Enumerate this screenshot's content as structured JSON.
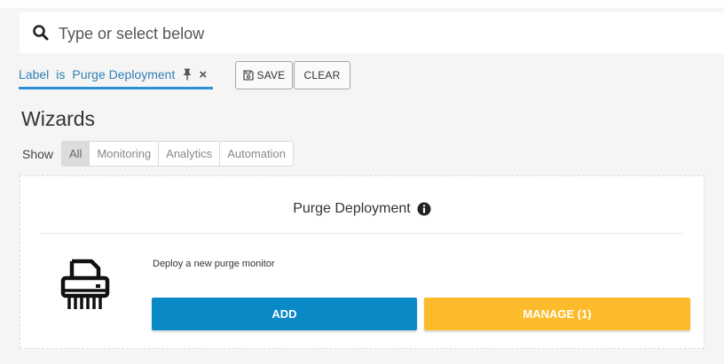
{
  "search": {
    "placeholder": "Type or select below",
    "icon": "search-icon"
  },
  "filter": {
    "key": "Label",
    "operator": "is",
    "value": "Purge Deployment",
    "pin_icon": "pin-icon",
    "remove_label": "×"
  },
  "toolbar": {
    "save_label": "SAVE",
    "clear_label": "CLEAR"
  },
  "page": {
    "title": "Wizards"
  },
  "show": {
    "label": "Show",
    "options": [
      "All",
      "Monitoring",
      "Analytics",
      "Automation"
    ],
    "selected": "All"
  },
  "card": {
    "title": "Purge Deployment",
    "info_icon": "info-icon",
    "image_icon": "shredder-icon",
    "description": "Deploy a new purge monitor",
    "add_label": "ADD",
    "manage_label": "MANAGE (1)"
  },
  "colors": {
    "accent_blue": "#2d8fd5",
    "add_button": "#0a89c7",
    "manage_button": "#fbbb2a",
    "background": "#f5f5f5"
  }
}
